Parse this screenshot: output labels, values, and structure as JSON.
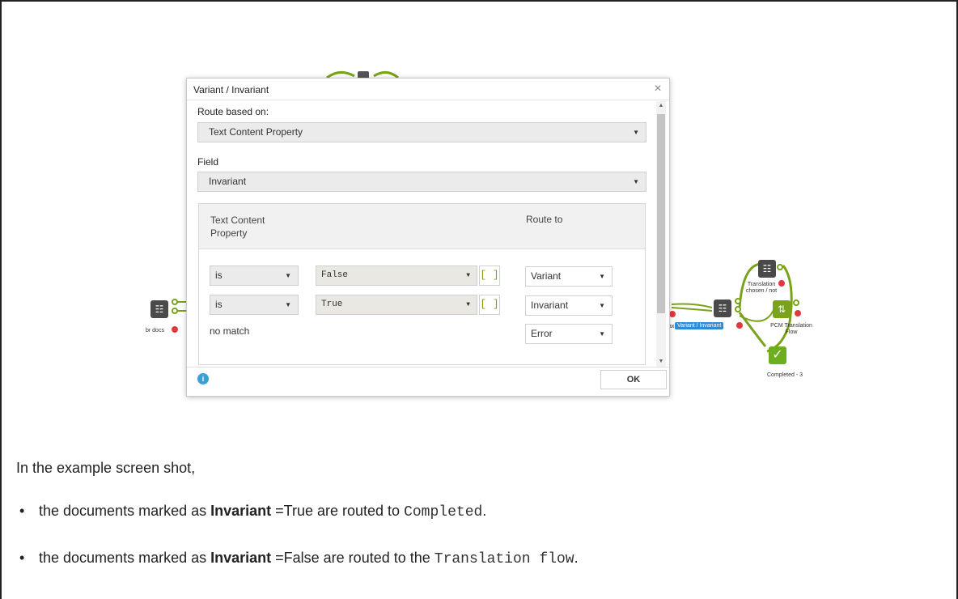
{
  "dialog": {
    "title": "Variant / Invariant",
    "close_glyph": "×",
    "route_based_on_label": "Route based on:",
    "route_based_on_value": "Text Content Property",
    "field_label": "Field",
    "field_value": "Invariant",
    "table_header_col1": "Text Content Property",
    "table_header_col2": "Route to",
    "rules": [
      {
        "operator": "is",
        "value": "False",
        "brackets": "[ ]",
        "route": "Variant"
      },
      {
        "operator": "is",
        "value": "True",
        "brackets": "[ ]",
        "route": "Invariant"
      }
    ],
    "no_match_label": "no match",
    "no_match_route": "Error",
    "ok_label": "OK",
    "info_icon": "info-icon"
  },
  "workflow": {
    "left_node_label": "br docs",
    "selected_node_label": "Variant / Invariant",
    "selected_node_prefix": "ax",
    "translation_chosen_label": "Translation chosen / not",
    "pcm_label": "PCM Translation Flow",
    "completed_label": "Completed - 3"
  },
  "text": {
    "intro": "In the example screen shot,",
    "bullet1": {
      "pre": "the documents marked as ",
      "bold": "Invariant",
      "mid": " =True are routed to ",
      "code": "Completed",
      "post": "."
    },
    "bullet2": {
      "pre": "the documents marked as ",
      "bold": "Invariant",
      "mid": " =False are routed to the ",
      "code": "Translation flow",
      "post": "."
    }
  },
  "colors": {
    "accent_green": "#7aa21a",
    "selected_blue": "#2e8bd8",
    "error_red": "#e0383d"
  }
}
